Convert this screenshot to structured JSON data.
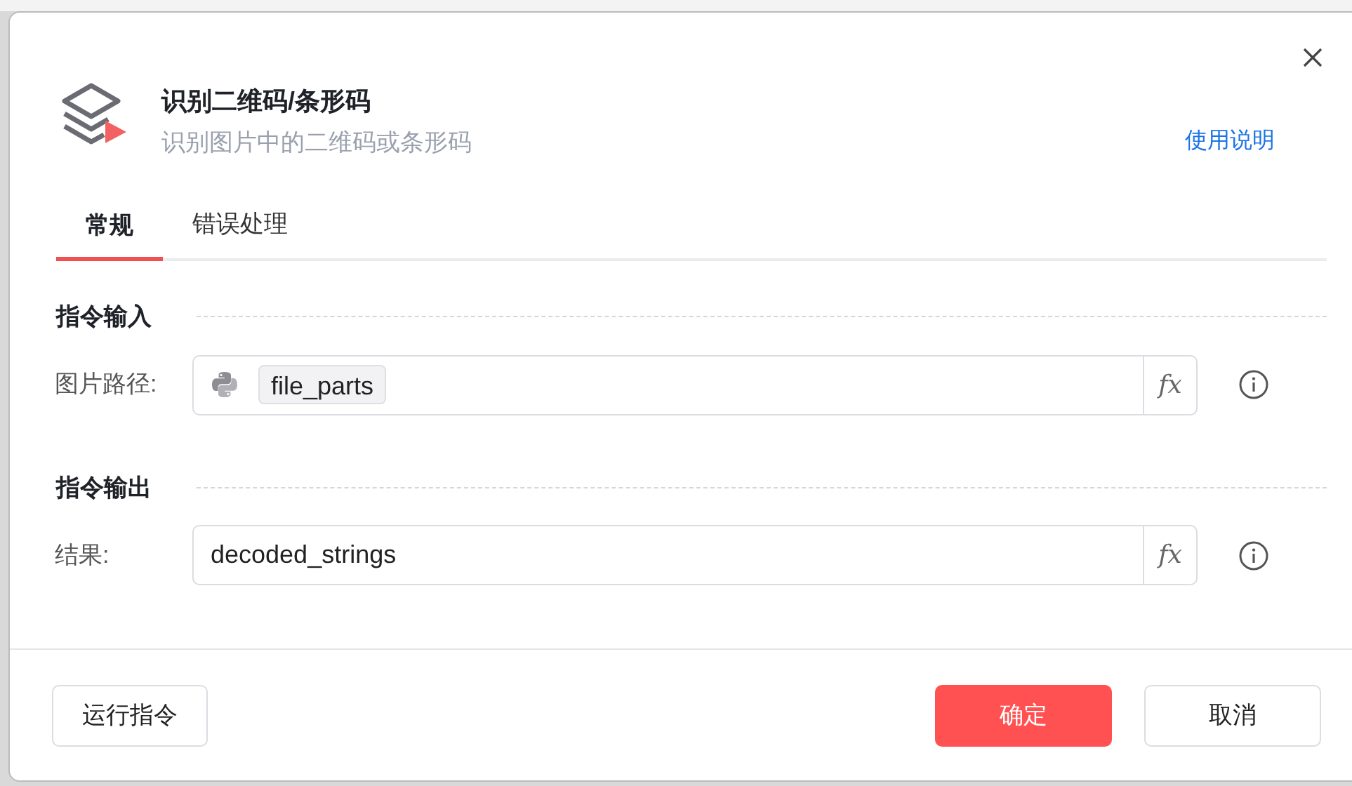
{
  "dialog": {
    "title": "识别二维码/条形码",
    "subtitle": "识别图片中的二维码或条形码",
    "help_link": "使用说明"
  },
  "tabs": [
    {
      "label": "常规",
      "selected": true
    },
    {
      "label": "错误处理",
      "selected": false
    }
  ],
  "sections": [
    {
      "title": "指令输入",
      "fields": [
        {
          "label": "图片路径:",
          "kind": "variable",
          "value": "file_parts",
          "fx_label": "𝑓x"
        }
      ]
    },
    {
      "title": "指令输出",
      "fields": [
        {
          "label": "结果:",
          "kind": "text",
          "value": "decoded_strings",
          "fx_label": "𝑓x"
        }
      ]
    }
  ],
  "buttons": [
    {
      "label": "运行指令",
      "kind": "secondary"
    },
    {
      "label": "确定",
      "kind": "primary"
    },
    {
      "label": "取消",
      "kind": "secondary"
    }
  ]
}
